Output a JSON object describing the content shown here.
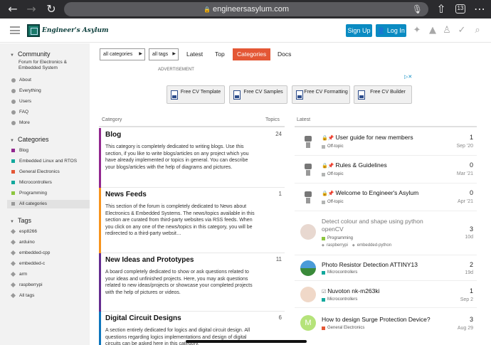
{
  "browser": {
    "url": "engineersasylum.com",
    "tab_count": "13"
  },
  "header": {
    "logo_text": "Engineer's Asylum",
    "signup": "Sign Up",
    "login": "Log In"
  },
  "sidebar": {
    "community": {
      "title": "Community",
      "subtitle": "Forum for Electronics & Embedded System",
      "items": [
        "About",
        "Everything",
        "Users",
        "FAQ",
        "More"
      ]
    },
    "categories": {
      "title": "Categories",
      "items": [
        {
          "label": "Blog",
          "color": "#92278f"
        },
        {
          "label": "Embedded Linux and RTOS",
          "color": "#12a89d"
        },
        {
          "label": "General Electronics",
          "color": "#e45735"
        },
        {
          "label": "Microcontrollers",
          "color": "#12a89d"
        },
        {
          "label": "Programming",
          "color": "#8dc63f"
        }
      ],
      "all": "All categories"
    },
    "tags": {
      "title": "Tags",
      "items": [
        "esp8266",
        "arduino",
        "embedded-cpp",
        "embedded-c",
        "arm",
        "raspberrypi",
        "All tags"
      ]
    }
  },
  "filters": {
    "category": "all categories",
    "tags": "all tags",
    "nav": [
      "Latest",
      "Top",
      "Categories",
      "Docs"
    ],
    "active": "Categories"
  },
  "ad": {
    "label": "ADVERTISEMENT",
    "buttons": [
      "Free CV Template",
      "Free CV Samples",
      "Free CV Formatting",
      "Free CV Builder"
    ]
  },
  "columns": {
    "category": "Category",
    "topics": "Topics",
    "latest": "Latest"
  },
  "categories": [
    {
      "title": "Blog",
      "count": "24",
      "color": "#92278f",
      "desc": "This category is completely dedicated to writing blogs. Use this section, if you like to write blogs/articles on any project which you have already implemented or topics in general. You can describe your blogs/articles with the help of diagrams and pictures."
    },
    {
      "title": "News Feeds",
      "count": "1",
      "color": "#f7941d",
      "desc": "This section of the forum is completely dedicated to News about Electronics & Embedded Systems. The news/topics available in this section are curated from third-party websites via RSS feeds. When you click on any one of the news/topics in this category, you will be redirected to a third-party websit…"
    },
    {
      "title": "New Ideas and Prototypes",
      "count": "11",
      "color": "#652d90",
      "desc": "A board completely dedicated to show or ask questions related to your ideas and unfinished projects. Here, you may ask questions related to new ideas/projects or showcase your completed projects with the help of pictures or videos."
    },
    {
      "title": "Digital Circuit Designs",
      "count": "6",
      "color": "#0e76bd",
      "desc": "A section entirely dedicated for logics and digital circuit design. All questions regarding logics implementations and design of digital circuits can be asked here in this category."
    }
  ],
  "topics": [
    {
      "title": "User guide for new members",
      "category": "Off-topic",
      "cat_color": "#b3b5b4",
      "count": "1",
      "date": "Sep '20",
      "pinned": true,
      "avatar": "robot"
    },
    {
      "title": "Rules & Guidelines",
      "category": "Off-topic",
      "cat_color": "#b3b5b4",
      "count": "0",
      "date": "Mar '21",
      "pinned": true,
      "avatar": "robot"
    },
    {
      "title": "Welcome to Engineer's Asylum",
      "category": "Off-topic",
      "cat_color": "#b3b5b4",
      "count": "0",
      "date": "Apr '21",
      "pinned": true,
      "avatar": "robot"
    },
    {
      "title": "Detect colour and shape using python openCV",
      "category": "Programming",
      "cat_color": "#8dc63f",
      "tags": [
        "raspberrypi",
        "embedded-python"
      ],
      "count": "3",
      "date": "10d",
      "avatar": "photo"
    },
    {
      "title": "Photo Resistor Detection ATTINY13",
      "category": "Microcontrollers",
      "cat_color": "#12a89d",
      "count": "2",
      "date": "19d",
      "avatar": "photo2"
    },
    {
      "title": "Nuvoton nk-m263ki",
      "category": "Microcontrollers",
      "cat_color": "#12a89d",
      "count": "1",
      "date": "Sep 2",
      "avatar": "person"
    },
    {
      "title": "How to design Surge Protection Device?",
      "category": "General Electronics",
      "cat_color": "#e45735",
      "count": "3",
      "date": "Aug 29",
      "avatar": "letter",
      "letter": "M"
    }
  ]
}
